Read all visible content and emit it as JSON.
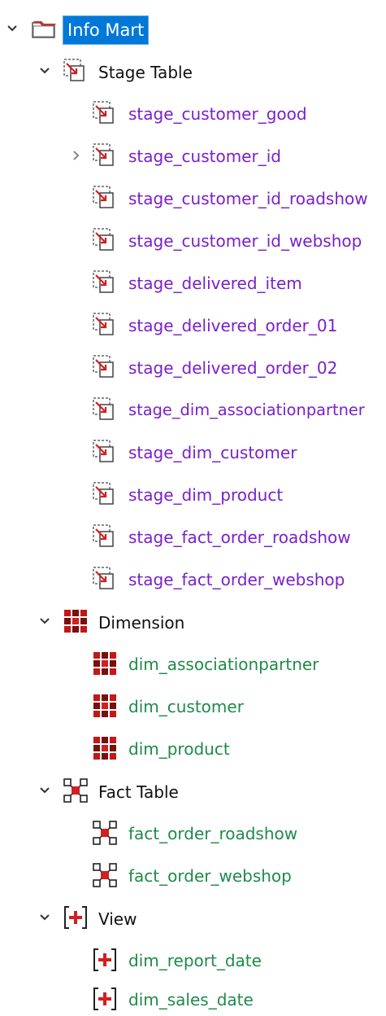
{
  "tree": {
    "root": {
      "label": "Info Mart",
      "icon": "folder-icon",
      "expanded": true
    },
    "groups": [
      {
        "label": "Stage Table",
        "icon": "stage-table-icon",
        "expanded": true,
        "color": "#7a1fcc",
        "children": [
          {
            "label": "stage_customer_good"
          },
          {
            "label": "stage_customer_id",
            "has_children": true
          },
          {
            "label": "stage_customer_id_roadshow"
          },
          {
            "label": "stage_customer_id_webshop"
          },
          {
            "label": "stage_delivered_item"
          },
          {
            "label": "stage_delivered_order_01"
          },
          {
            "label": "stage_delivered_order_02"
          },
          {
            "label": "stage_dim_associationpartner"
          },
          {
            "label": "stage_dim_customer"
          },
          {
            "label": "stage_dim_product"
          },
          {
            "label": "stage_fact_order_roadshow"
          },
          {
            "label": "stage_fact_order_webshop"
          }
        ]
      },
      {
        "label": "Dimension",
        "icon": "dimension-icon",
        "expanded": true,
        "color": "#1f8a4a",
        "children": [
          {
            "label": "dim_associationpartner"
          },
          {
            "label": "dim_customer"
          },
          {
            "label": "dim_product"
          }
        ]
      },
      {
        "label": "Fact Table",
        "icon": "fact-table-icon",
        "expanded": true,
        "color": "#1f8a4a",
        "children": [
          {
            "label": "fact_order_roadshow"
          },
          {
            "label": "fact_order_webshop"
          }
        ]
      },
      {
        "label": "View",
        "icon": "view-icon",
        "expanded": true,
        "color": "#1f8a4a",
        "children": [
          {
            "label": "dim_report_date"
          },
          {
            "label": "dim_sales_date"
          }
        ]
      }
    ]
  },
  "colors": {
    "selection": "#0078d7",
    "stage_text": "#7a1fcc",
    "object_text": "#1f8a4a",
    "group_text": "#111111",
    "icon_red": "#d21f1f"
  }
}
